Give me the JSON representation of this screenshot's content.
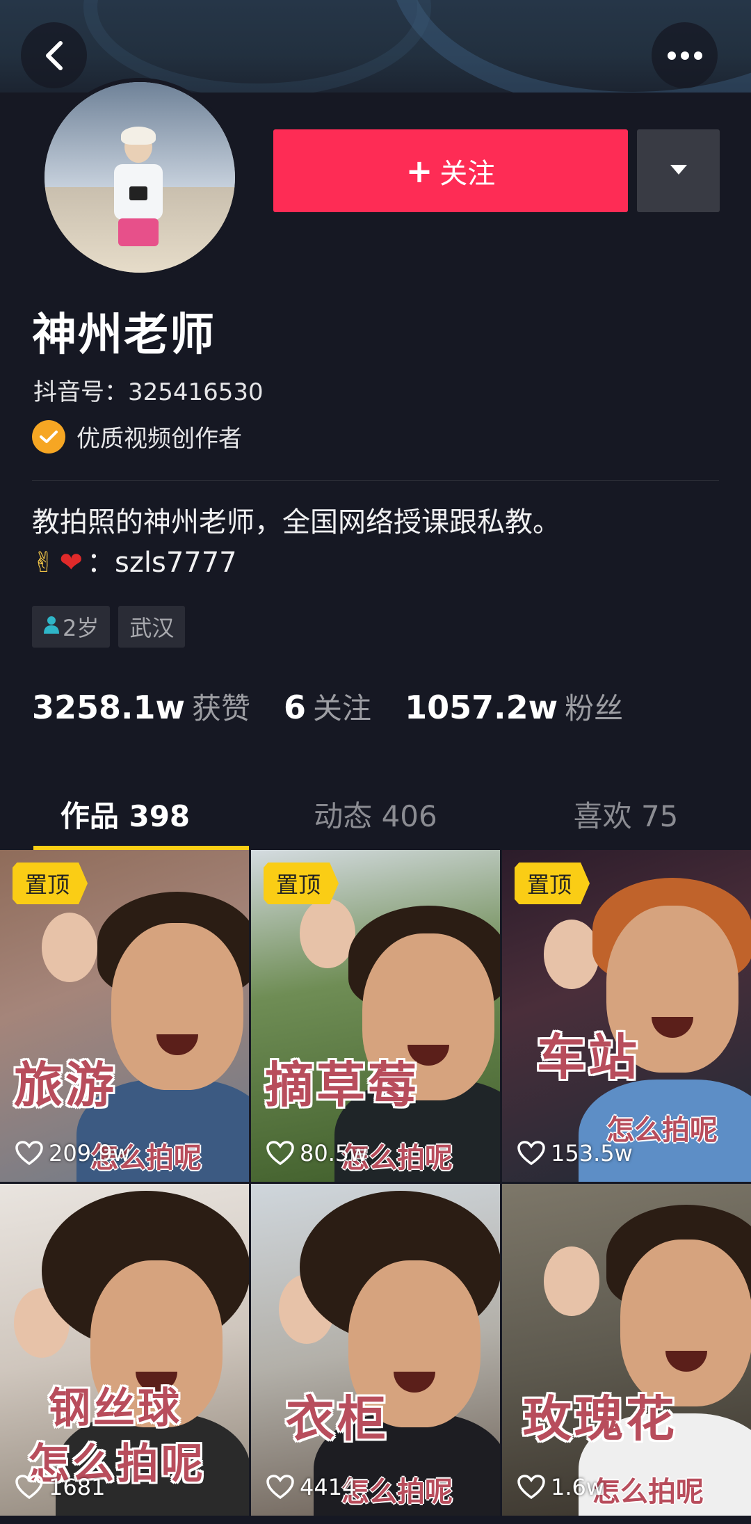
{
  "header": {
    "back_icon": "chevron-left-icon",
    "more_icon": "more-horizontal-icon"
  },
  "profile": {
    "name": "神州老师",
    "douyin_id": "抖音号：325416530",
    "badge_text": "优质视频创作者",
    "bio_line1": "教拍照的神州老师，全国网络授课跟私教。",
    "bio_line2_emoji1": "✌",
    "bio_line2_emoji2": "❤",
    "bio_line2_text": "：szls7777",
    "tags": [
      {
        "icon": "person-icon",
        "label": "2岁"
      },
      {
        "label": "武汉"
      }
    ]
  },
  "actions": {
    "follow_plus": "+",
    "follow_label": "关注",
    "dropdown_icon": "caret-down-icon",
    "accent_color": "#fe2c55"
  },
  "stats": [
    {
      "value": "3258.1w",
      "label": "获赞"
    },
    {
      "value": "6",
      "label": "关注"
    },
    {
      "value": "1057.2w",
      "label": "粉丝"
    }
  ],
  "tabs": [
    {
      "label": "作品 398",
      "active": true
    },
    {
      "label": "动态 406",
      "active": false
    },
    {
      "label": "喜欢 75",
      "active": false
    }
  ],
  "videos": [
    {
      "pinned": "置顶",
      "caption": "旅游",
      "subcaption": "怎么拍呢",
      "likes": "209.9w"
    },
    {
      "pinned": "置顶",
      "caption": "摘草莓",
      "subcaption": "怎么拍呢",
      "likes": "80.5w"
    },
    {
      "pinned": "置顶",
      "caption": "车站",
      "subcaption": "怎么拍呢",
      "likes": "153.5w"
    },
    {
      "caption": "钢丝球",
      "subcaption": "怎么拍呢",
      "likes": "1681"
    },
    {
      "caption": "衣柜",
      "subcaption": "怎么拍呢",
      "likes": "4414"
    },
    {
      "caption": "玫瑰花",
      "subcaption": "怎么拍呢",
      "likes": "1.6w"
    }
  ]
}
